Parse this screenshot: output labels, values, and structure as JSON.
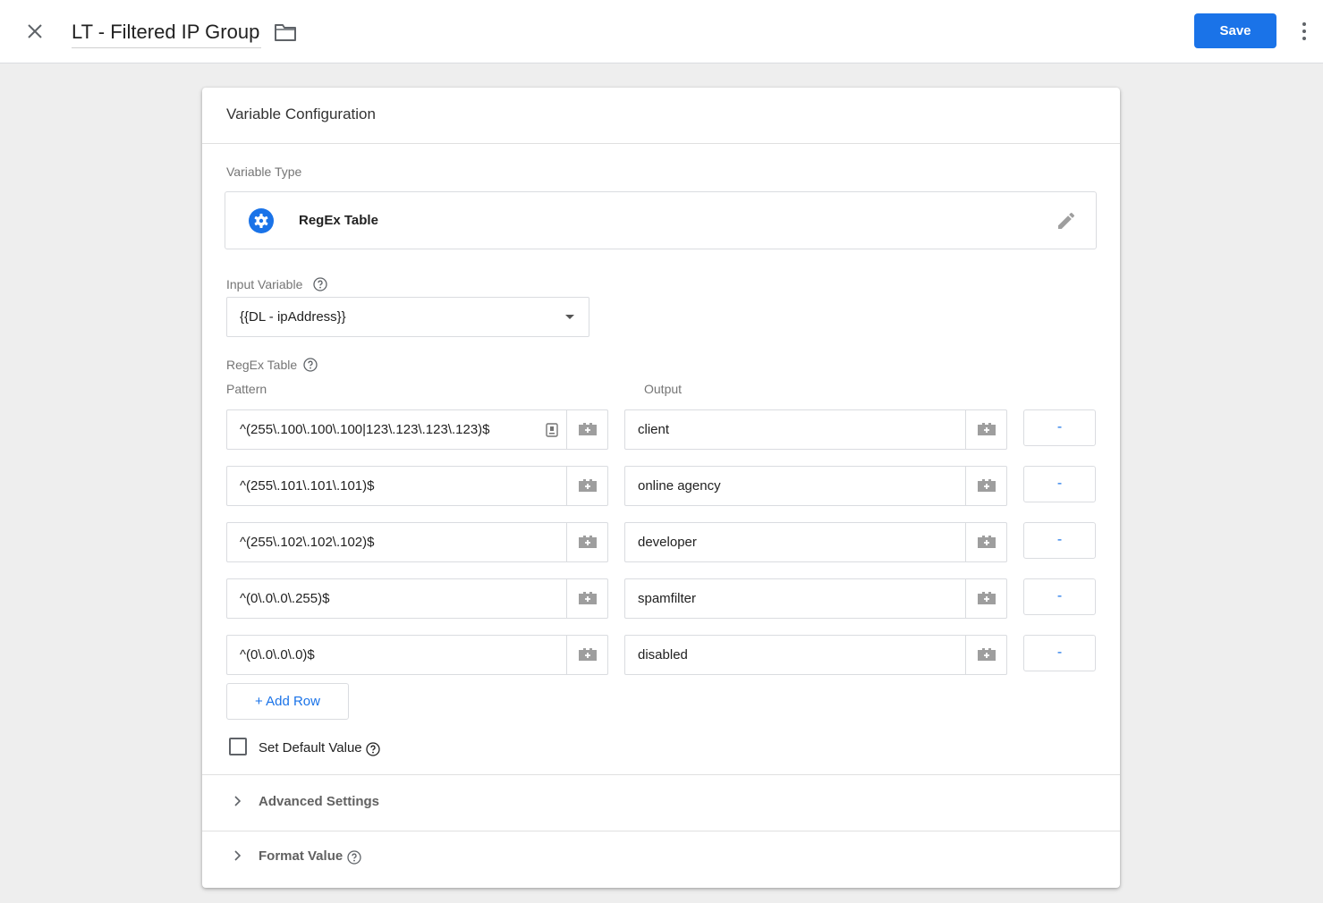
{
  "header": {
    "title": "LT - Filtered IP Group",
    "save_label": "Save",
    "icons": {
      "close": "close-icon",
      "folder": "folder-icon",
      "more": "more-vert-icon"
    },
    "accent_color": "#1a73e8"
  },
  "card": {
    "title": "Variable Configuration",
    "variable_type": {
      "label": "Variable Type",
      "name": "RegEx Table",
      "icon": "gear-icon",
      "icon_color": "#1a73e8"
    },
    "input_variable": {
      "label": "Input Variable",
      "value": "{{DL - ipAddress}}"
    },
    "regex_table": {
      "label": "RegEx Table",
      "pattern_header": "Pattern",
      "output_header": "Output",
      "rows": [
        {
          "pattern": "^(255\\.100\\.100\\.100|123\\.123\\.123\\.123)$",
          "output": "client"
        },
        {
          "pattern": "^(255\\.101\\.101\\.101)$",
          "output": "online agency"
        },
        {
          "pattern": "^(255\\.102\\.102\\.102)$",
          "output": "developer"
        },
        {
          "pattern": "^(0\\.0\\.0\\.255)$",
          "output": "spamfilter"
        },
        {
          "pattern": "^(0\\.0\\.0\\.0)$",
          "output": "disabled"
        }
      ],
      "remove_label": "-",
      "add_row_label": "+ Add Row"
    },
    "default_value": {
      "label": "Set Default Value",
      "checked": false
    },
    "sections": {
      "advanced": "Advanced Settings",
      "format": "Format Value"
    }
  }
}
